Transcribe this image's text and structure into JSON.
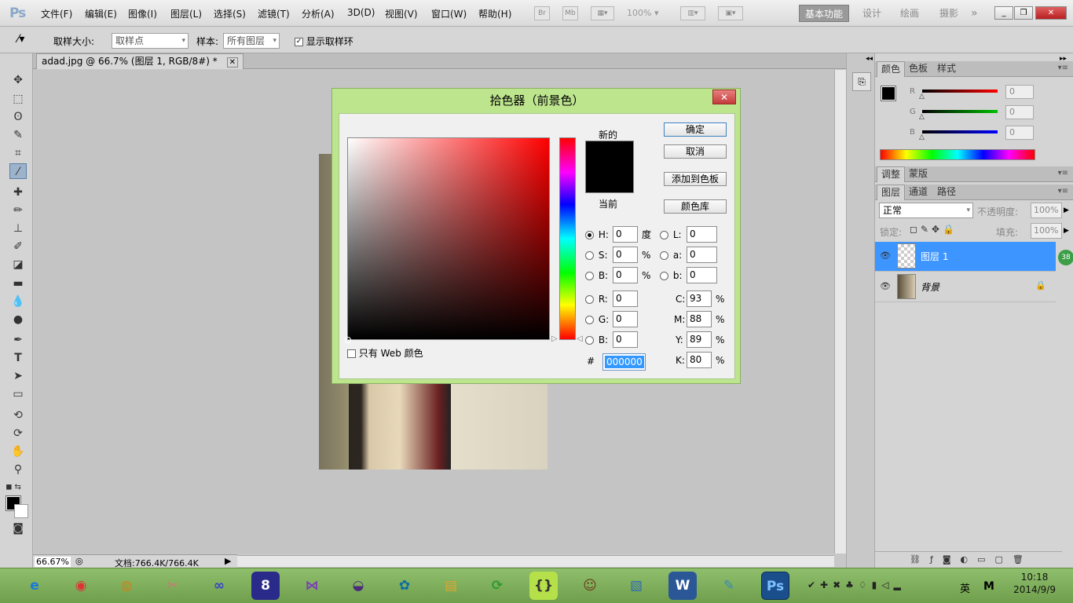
{
  "app": {
    "menus": [
      "文件(F)",
      "编辑(E)",
      "图像(I)",
      "图层(L)",
      "选择(S)",
      "滤镜(T)",
      "分析(A)",
      "3D(D)",
      "视图(V)",
      "窗口(W)",
      "帮助(H)"
    ],
    "zoom_select": "100%",
    "workspaces": [
      "基本功能",
      "设计",
      "绘画",
      "摄影"
    ],
    "icons": {
      "bridge": "Br",
      "minibridge": "Mb"
    }
  },
  "options": {
    "sample_size_label": "取样大小:",
    "sample_size_value": "取样点",
    "sample_label": "样本:",
    "sample_value": "所有图层",
    "show_ring_label": "显示取样环"
  },
  "document": {
    "tab_title": "adad.jpg @ 66.7% (图层 1, RGB/8#) *",
    "zoom": "66.67%",
    "doc_size": "文档:766.4K/766.4K"
  },
  "dialog": {
    "title": "拾色器（前景色）",
    "new_label": "新的",
    "current_label": "当前",
    "ok": "确定",
    "cancel": "取消",
    "add_swatch": "添加到色板",
    "color_library": "颜色库",
    "web_only": "只有 Web 颜色",
    "hsb": [
      {
        "label": "H:",
        "value": "0",
        "unit": "度"
      },
      {
        "label": "S:",
        "value": "0",
        "unit": "%"
      },
      {
        "label": "B:",
        "value": "0",
        "unit": "%"
      }
    ],
    "rgb": [
      {
        "label": "R:",
        "value": "0"
      },
      {
        "label": "G:",
        "value": "0"
      },
      {
        "label": "B:",
        "value": "0"
      }
    ],
    "lab": [
      {
        "label": "L:",
        "value": "0"
      },
      {
        "label": "a:",
        "value": "0"
      },
      {
        "label": "b:",
        "value": "0"
      }
    ],
    "cmyk": [
      {
        "label": "C:",
        "value": "93",
        "unit": "%"
      },
      {
        "label": "M:",
        "value": "88",
        "unit": "%"
      },
      {
        "label": "Y:",
        "value": "89",
        "unit": "%"
      },
      {
        "label": "K:",
        "value": "80",
        "unit": "%"
      }
    ],
    "hex_label": "#",
    "hex_value": "000000"
  },
  "panels": {
    "color_tabs": [
      "颜色",
      "色板",
      "样式"
    ],
    "rgb_sliders": [
      {
        "label": "R",
        "value": "0",
        "color": "#ff0000"
      },
      {
        "label": "G",
        "value": "0",
        "color": "#00c000"
      },
      {
        "label": "B",
        "value": "0",
        "color": "#0000ff"
      }
    ],
    "adjust_tabs": [
      "调整",
      "蒙版"
    ],
    "layer_tabs": [
      "图层",
      "通道",
      "路径"
    ],
    "blend_mode": "正常",
    "opacity_label": "不透明度:",
    "opacity_value": "100%",
    "lock_label": "锁定:",
    "fill_label": "填充:",
    "fill_value": "100%",
    "layers": [
      {
        "name": "图层 1",
        "selected": true
      },
      {
        "name": "背景",
        "selected": false
      }
    ],
    "badge": "38"
  },
  "taskbar": {
    "ime": "英",
    "time": "10:18",
    "date": "2014/9/9"
  }
}
